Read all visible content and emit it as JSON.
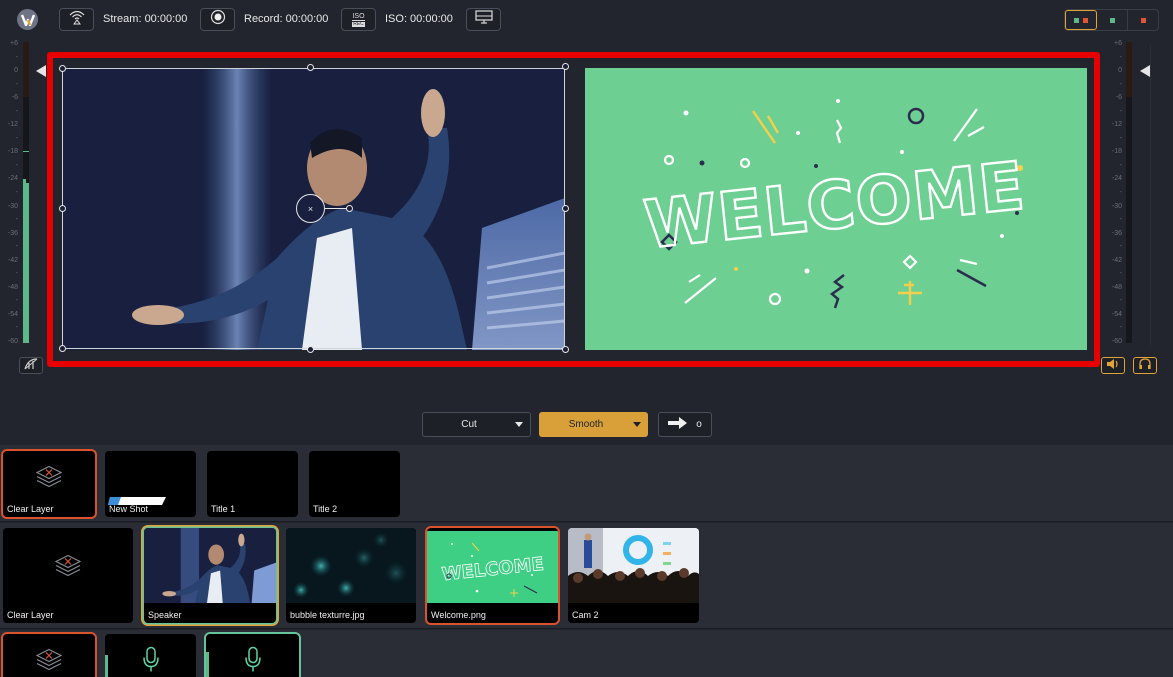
{
  "topbar": {
    "logo": "wirecast-logo-icon",
    "stream_label": "Stream: 00:00:00",
    "record_label": "Record: 00:00:00",
    "iso_label": "ISO: 00:00:00",
    "iso_button_top": "ISO",
    "iso_button_bottom": "REC",
    "icons": [
      "broadcast-icon",
      "record-icon",
      "iso-rec-icon",
      "monitor-icon"
    ],
    "view_toggle": [
      {
        "name": "preview-program-layout",
        "active": true
      },
      {
        "name": "preview-only-layout",
        "active": false
      },
      {
        "name": "program-only-layout",
        "active": false
      }
    ]
  },
  "colors": {
    "accent": "#e0a43a",
    "preview_green": "#5db98a",
    "program_red": "#e05533",
    "highlight_red": "#e60000",
    "background": "#22252d"
  },
  "meters": {
    "scale": [
      "+6",
      "-",
      "0",
      "-",
      "-6",
      "-",
      "-12",
      "-",
      "-18",
      "-",
      "-24",
      "-",
      "-30",
      "-",
      "-36",
      "-",
      "-42",
      "-",
      "-48",
      "-",
      "-54",
      "-",
      "-60"
    ],
    "left_level_db": [
      -24,
      -25
    ],
    "left_peak_db": -18,
    "right_level_db": [
      -60,
      -60
    ],
    "volume_db": 0
  },
  "preview": {
    "label": "Speaker",
    "selection_handles": true
  },
  "program": {
    "label": "Welcome",
    "welcome_text": "WELCOME"
  },
  "transitions": {
    "cut_label": "Cut",
    "smooth_label": "Smooth",
    "go_arrow": "go-arrow-icon",
    "indicator": "o"
  },
  "layers": {
    "row1": [
      {
        "name": "Clear Layer",
        "type": "clear",
        "state": "live"
      },
      {
        "name": "New Shot",
        "type": "lower-third",
        "state": "none"
      },
      {
        "name": "Title 1",
        "type": "empty",
        "state": "none"
      },
      {
        "name": "Title 2",
        "type": "empty",
        "state": "none"
      }
    ],
    "row2": [
      {
        "name": "Clear Layer",
        "type": "clear",
        "state": "none"
      },
      {
        "name": "Speaker",
        "type": "speaker",
        "state": "preview"
      },
      {
        "name": "bubble texturre.jpg",
        "type": "bubbles",
        "state": "none"
      },
      {
        "name": "Welcome.png",
        "type": "welcome",
        "state": "live"
      },
      {
        "name": "Cam 2",
        "type": "cam2",
        "state": "none"
      }
    ],
    "row3": [
      {
        "name": "Clear Layer",
        "type": "clear",
        "state": "live"
      },
      {
        "name": "",
        "type": "mic",
        "state": "none"
      },
      {
        "name": "",
        "type": "mic",
        "state": "preview"
      }
    ]
  }
}
